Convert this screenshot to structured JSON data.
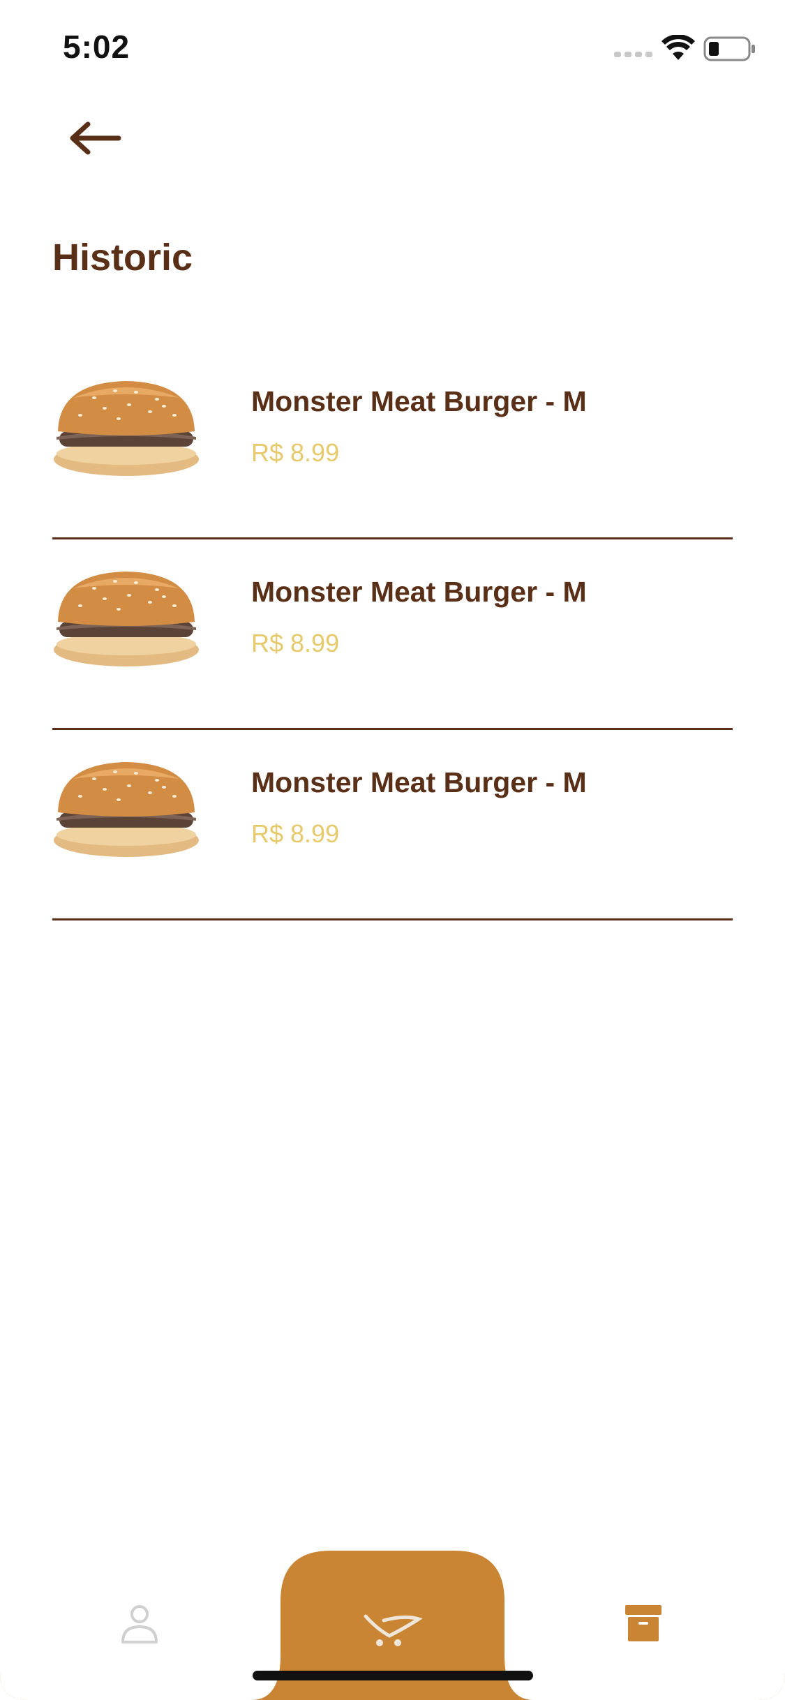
{
  "status_bar": {
    "time": "5:02",
    "icons": [
      "signal-icon",
      "wifi-icon",
      "battery-icon"
    ]
  },
  "header": {
    "back_icon": "arrow-left-icon",
    "title": "Historic"
  },
  "history": [
    {
      "name": "Monster Meat Burger - M",
      "price": "R$ 8.99",
      "image": "burger-image"
    },
    {
      "name": "Monster Meat Burger - M",
      "price": "R$ 8.99",
      "image": "burger-image"
    },
    {
      "name": "Monster Meat Burger - M",
      "price": "R$ 8.99",
      "image": "burger-image"
    }
  ],
  "bottom_nav": {
    "items": [
      "user-icon",
      "cart-icon",
      "archive-icon"
    ],
    "active": "cart-icon"
  },
  "colors": {
    "primary_brown": "#5a2f17",
    "price_yellow": "#e6c96b",
    "accent_orange": "#c98534",
    "inactive_icon": "#d0d0d0"
  }
}
